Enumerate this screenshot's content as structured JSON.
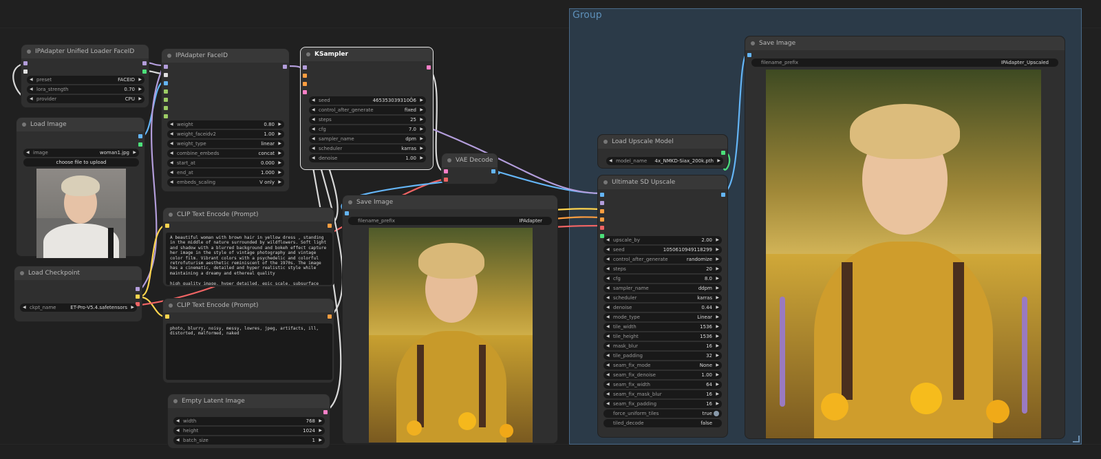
{
  "group": {
    "title": "Group"
  },
  "nodes": {
    "ipadapter_loader": {
      "title": "IPAdapter Unified Loader FaceID",
      "widgets": [
        {
          "label": "preset",
          "value": "FACEID"
        },
        {
          "label": "lora_strength",
          "value": "0.70"
        },
        {
          "label": "provider",
          "value": "CPU"
        }
      ]
    },
    "load_image": {
      "title": "Load Image",
      "image_widget": {
        "label": "image",
        "value": "woman1.jpg"
      },
      "upload_button": "choose file to upload"
    },
    "load_checkpoint": {
      "title": "Load Checkpoint",
      "widgets": [
        {
          "label": "ckpt_name",
          "value": "ET-Pro-V5.4.safetensors"
        }
      ]
    },
    "ipadapter_faceid": {
      "title": "IPAdapter FaceID",
      "widgets": [
        {
          "label": "weight",
          "value": "0.80"
        },
        {
          "label": "weight_faceidv2",
          "value": "1.00"
        },
        {
          "label": "weight_type",
          "value": "linear"
        },
        {
          "label": "combine_embeds",
          "value": "concat"
        },
        {
          "label": "start_at",
          "value": "0.000"
        },
        {
          "label": "end_at",
          "value": "1.000"
        },
        {
          "label": "embeds_scaling",
          "value": "V only"
        }
      ]
    },
    "clip_positive": {
      "title": "CLIP Text Encode (Prompt)",
      "text": "A beautiful woman with brown hair in yellow dress , standing in the middle of nature surrounded by wildflowers. Soft light and shadow with a blurred background and bokeh effect capture her image in the style of vintage photography and vintage color film. Vibrant colors with a psychedelic and colorful retrofuturism aesthetic reminiscent of the 1970s. The image has a cinematic, detailed and hyper realistic style while maintaining a dreamy and ethereal quality\n\nhigh quality image, hyper detailed, epic scale, subsurface"
    },
    "clip_negative": {
      "title": "CLIP Text Encode (Prompt)",
      "text": "photo, blurry, noisy, messy, lowres, jpeg, artifacts, ill, distorted, malformed, naked"
    },
    "empty_latent": {
      "title": "Empty Latent Image",
      "widgets": [
        {
          "label": "width",
          "value": "768"
        },
        {
          "label": "height",
          "value": "1024"
        },
        {
          "label": "batch_size",
          "value": "1"
        }
      ]
    },
    "ksampler": {
      "title": "KSampler",
      "widgets": [
        {
          "label": "seed",
          "value": "465353039310Ō6"
        },
        {
          "label": "control_after_generate",
          "value": "fixed"
        },
        {
          "label": "steps",
          "value": "25"
        },
        {
          "label": "cfg",
          "value": "7.0"
        },
        {
          "label": "sampler_name",
          "value": "dpm"
        },
        {
          "label": "scheduler",
          "value": "karras"
        },
        {
          "label": "denoise",
          "value": "1.00"
        }
      ]
    },
    "vae_decode": {
      "title": "VAE Decode"
    },
    "save_image": {
      "title": "Save Image",
      "widgets": [
        {
          "label": "filename_prefix",
          "value": "IPAdapter"
        }
      ]
    },
    "load_upscale": {
      "title": "Load Upscale Model",
      "widgets": [
        {
          "label": "model_name",
          "value": "4x_NMKD-Siax_200k.pth"
        }
      ]
    },
    "ultimate_sd": {
      "title": "Ultimate SD Upscale",
      "widgets": [
        {
          "label": "upscale_by",
          "value": "2.00"
        },
        {
          "label": "seed",
          "value": "1050610949118299"
        },
        {
          "label": "control_after_generate",
          "value": "randomize"
        },
        {
          "label": "steps",
          "value": "20"
        },
        {
          "label": "cfg",
          "value": "8.0"
        },
        {
          "label": "sampler_name",
          "value": "ddpm"
        },
        {
          "label": "scheduler",
          "value": "karras"
        },
        {
          "label": "denoise",
          "value": "0.44"
        },
        {
          "label": "mode_type",
          "value": "Linear"
        },
        {
          "label": "tile_width",
          "value": "1536"
        },
        {
          "label": "tile_height",
          "value": "1536"
        },
        {
          "label": "mask_blur",
          "value": "16"
        },
        {
          "label": "tile_padding",
          "value": "32"
        },
        {
          "label": "seam_fix_mode",
          "value": "None"
        },
        {
          "label": "seam_fix_denoise",
          "value": "1.00"
        },
        {
          "label": "seam_fix_width",
          "value": "64"
        },
        {
          "label": "seam_fix_mask_blur",
          "value": "16"
        },
        {
          "label": "seam_fix_padding",
          "value": "16"
        },
        {
          "label": "force_uniform_tiles",
          "value": "true"
        },
        {
          "label": "tiled_decode",
          "value": "false"
        }
      ]
    },
    "save_image_upscaled": {
      "title": "Save Image",
      "widgets": [
        {
          "label": "filename_prefix",
          "value": "IPAdapter_Upscaled"
        }
      ]
    }
  },
  "icons": {
    "widget_left": "◀",
    "widget_right": "▶"
  },
  "colors": {
    "canvas": "#202020",
    "group": "#2b3a48",
    "node": "#2f2f2f",
    "model_port": "#b39ddb",
    "clip_port": "#ffd54f",
    "conditioning_port": "#ff9e40",
    "latent_port": "#ff80c8",
    "image_port": "#64b5f6",
    "vae_port": "#ef6464"
  }
}
